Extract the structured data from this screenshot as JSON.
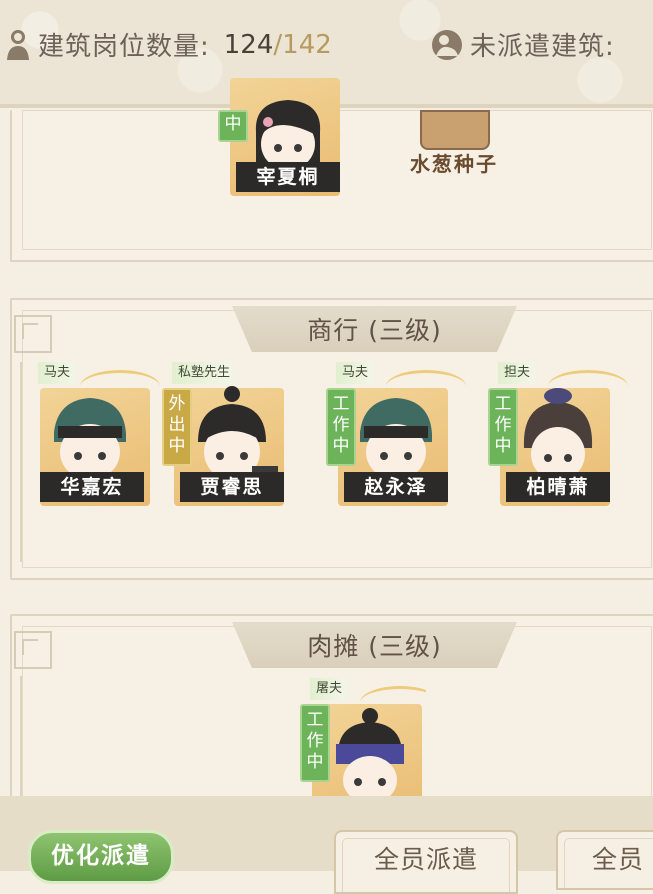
{
  "header": {
    "assigned_label": "建筑岗位数量:",
    "assigned_count": "124",
    "slash": "/",
    "assigned_total": "142",
    "unassigned_label": "未派遣建筑:"
  },
  "top_section": {
    "worker": {
      "status": "中",
      "name": "宰夏桐"
    },
    "item_name": "水葱种子"
  },
  "sections": [
    {
      "title": "商行 (三级)",
      "workers": [
        {
          "role": "马夫",
          "status": "",
          "name": "华嘉宏"
        },
        {
          "role": "私塾先生",
          "status": "外出中",
          "name": "贾睿思"
        },
        {
          "role": "马夫",
          "status": "工作中",
          "name": "赵永泽"
        },
        {
          "role": "担夫",
          "status": "工作中",
          "name": "柏晴萧"
        }
      ]
    },
    {
      "title": "肉摊 (三级)",
      "workers": [
        {
          "role": "屠夫",
          "status": "工作中",
          "name": ""
        }
      ]
    }
  ],
  "footer": {
    "optimize_label": "优化派遣",
    "dispatch_all_label": "全员派遣",
    "dispatch_all_label_2": "全员"
  },
  "colors": {
    "working": "#6cb35a",
    "out": "#c9a846",
    "accent_gold": "#b69a5e"
  },
  "icons": [
    "person-icon",
    "building-icon"
  ]
}
